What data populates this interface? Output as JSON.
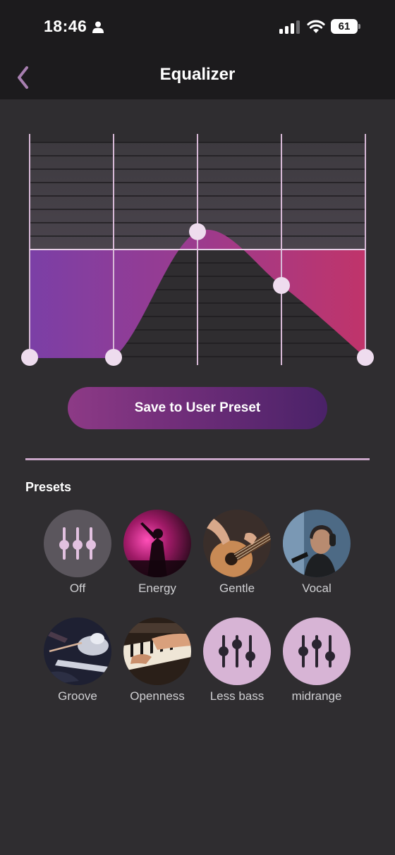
{
  "status_bar": {
    "time": "18:46",
    "battery": "61"
  },
  "header": {
    "title": "Equalizer"
  },
  "equalizer": {
    "band_count": 5,
    "levels": [
      -6,
      -6,
      1,
      -2,
      -6
    ],
    "level_range": [
      -6,
      6
    ],
    "colors": {
      "left": "#7b3fa6",
      "right": "#c0346a",
      "knob": "#eedcee",
      "grid": "#d7b8d6"
    }
  },
  "save_button_label": "Save to User Preset",
  "presets_heading": "Presets",
  "presets": [
    {
      "label": "Off",
      "icon": "sliders-icon"
    },
    {
      "label": "Energy",
      "icon": "concert-photo"
    },
    {
      "label": "Gentle",
      "icon": "guitar-photo"
    },
    {
      "label": "Vocal",
      "icon": "singer-photo"
    },
    {
      "label": "Groove",
      "icon": "drummer-photo"
    },
    {
      "label": "Openness",
      "icon": "piano-photo"
    },
    {
      "label": "Less bass",
      "icon": "sliders-icon"
    },
    {
      "label": "midrange",
      "icon": "sliders-icon"
    }
  ]
}
